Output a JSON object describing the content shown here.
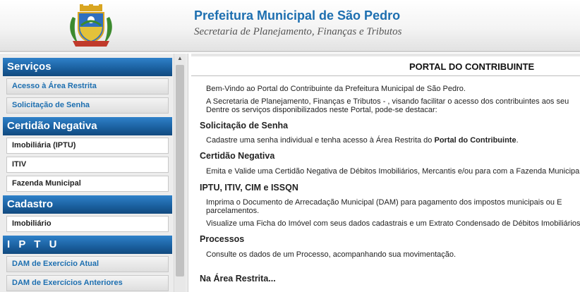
{
  "header": {
    "title": "Prefeitura Municipal de São Pedro",
    "subtitle": "Secretaria de Planejamento, Finanças e Tributos"
  },
  "sidebar": {
    "sections": [
      {
        "title": "Serviços",
        "items": [
          "Acesso à Área Restrita",
          "Solicitação de Senha"
        ]
      },
      {
        "title": "Certidão Negativa",
        "items": [
          "Imobiliária (IPTU)",
          "ITIV",
          "Fazenda Municipal"
        ]
      },
      {
        "title": "Cadastro",
        "items": [
          "Imobiliário"
        ]
      },
      {
        "title": "I P T U",
        "items": [
          "DAM de Exercício Atual",
          "DAM de Exercícios Anteriores"
        ]
      }
    ]
  },
  "content": {
    "portal_title": "PORTAL DO CONTRIBUINTE",
    "welcome": "Bem-Vindo ao Portal do Contribuinte da Prefeitura Municipal de São Pedro.",
    "intro_line1": "A Secretaria de Planejamento, Finanças e Tributos - , visando facilitar o acesso dos contribuintes aos seu",
    "intro_line2": "Dentre os serviços disponibilizados neste Portal, pode-se destacar:",
    "sections": [
      {
        "heading": "Solicitação de Senha",
        "text": "Cadastre uma senha individual e tenha acesso à Área Restrita do",
        "bold": "Portal do Contribuinte"
      },
      {
        "heading": "Certidão Negativa",
        "text": "Emita e Valide uma Certidão Negativa de Débitos Imobiliários, Mercantis e/ou para com a Fazenda Municipal."
      },
      {
        "heading": "IPTU, ITIV, CIM e ISSQN",
        "line1": "Imprima o Documento de Arrecadação Municipal (DAM) para pagamento dos impostos municipais ou E",
        "line2": "parcelamentos.",
        "line3": "Visualize uma Ficha do Imóvel com seus dados cadastrais e um Extrato Condensado de Débitos Imobiliários."
      },
      {
        "heading": "Processos",
        "text": "Consulte os dados de um Processo, acompanhando sua movimentação."
      }
    ],
    "restricted_heading": "Na Área Restrita..."
  },
  "colors": {
    "header_blue": "#1d6fb0",
    "section_head_blue": "#1a5f9e",
    "link_blue": "#1d6fb0"
  }
}
